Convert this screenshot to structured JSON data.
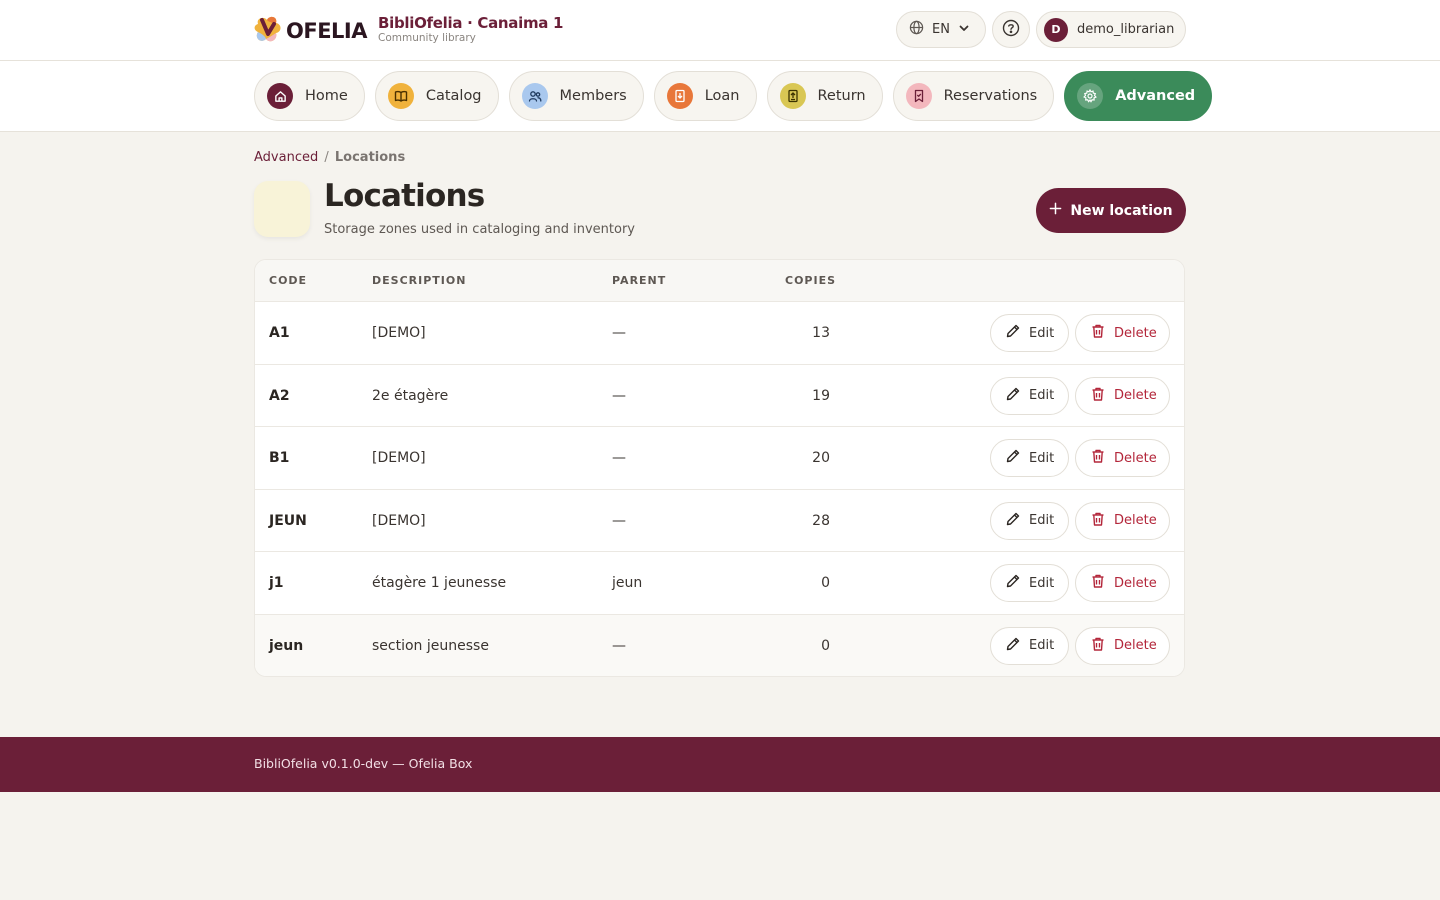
{
  "header": {
    "logo_text": "OFELIA",
    "app_title": "BibliOfelia · Canaima 1",
    "app_subtitle": "Community library",
    "language": "EN",
    "user_initial": "D",
    "username": "demo_librarian"
  },
  "nav": {
    "items": [
      {
        "label": "Home",
        "icon": "home-icon",
        "color": "#6b1f38"
      },
      {
        "label": "Catalog",
        "icon": "book-icon",
        "color": "#f0b23c"
      },
      {
        "label": "Members",
        "icon": "users-icon",
        "color": "#a9c8ee"
      },
      {
        "label": "Loan",
        "icon": "loan-icon",
        "color": "#e8773a"
      },
      {
        "label": "Return",
        "icon": "return-icon",
        "color": "#d9c754"
      },
      {
        "label": "Reservations",
        "icon": "bookmark-icon",
        "color": "#f3b7bd"
      },
      {
        "label": "Advanced",
        "icon": "gear-icon",
        "color": "#3b8b5a"
      }
    ],
    "active": "Advanced"
  },
  "breadcrumb": {
    "parent": "Advanced",
    "separator": "/",
    "current": "Locations"
  },
  "page": {
    "title": "Locations",
    "subtitle": "Storage zones used in cataloging and inventory",
    "new_button": "New location"
  },
  "table": {
    "columns": [
      "CODE",
      "DESCRIPTION",
      "PARENT",
      "COPIES"
    ],
    "rows": [
      {
        "code": "A1",
        "description": "[DEMO]",
        "parent": "—",
        "copies": "13"
      },
      {
        "code": "A2",
        "description": "2e étagère",
        "parent": "—",
        "copies": "19"
      },
      {
        "code": "B1",
        "description": "[DEMO]",
        "parent": "—",
        "copies": "20"
      },
      {
        "code": "JEUN",
        "description": "[DEMO]",
        "parent": "—",
        "copies": "28"
      },
      {
        "code": "j1",
        "description": "étagère 1 jeunesse",
        "parent": "jeun",
        "copies": "0"
      },
      {
        "code": "jeun",
        "description": "section jeunesse",
        "parent": "—",
        "copies": "0"
      }
    ],
    "edit_label": "Edit",
    "delete_label": "Delete"
  },
  "footer": {
    "text": "BibliOfelia v0.1.0-dev — Ofelia Box"
  },
  "colors": {
    "brand": "#6b1f38",
    "accent_green": "#3b8b5a",
    "danger": "#b3263a",
    "background": "#f5f3ee"
  }
}
